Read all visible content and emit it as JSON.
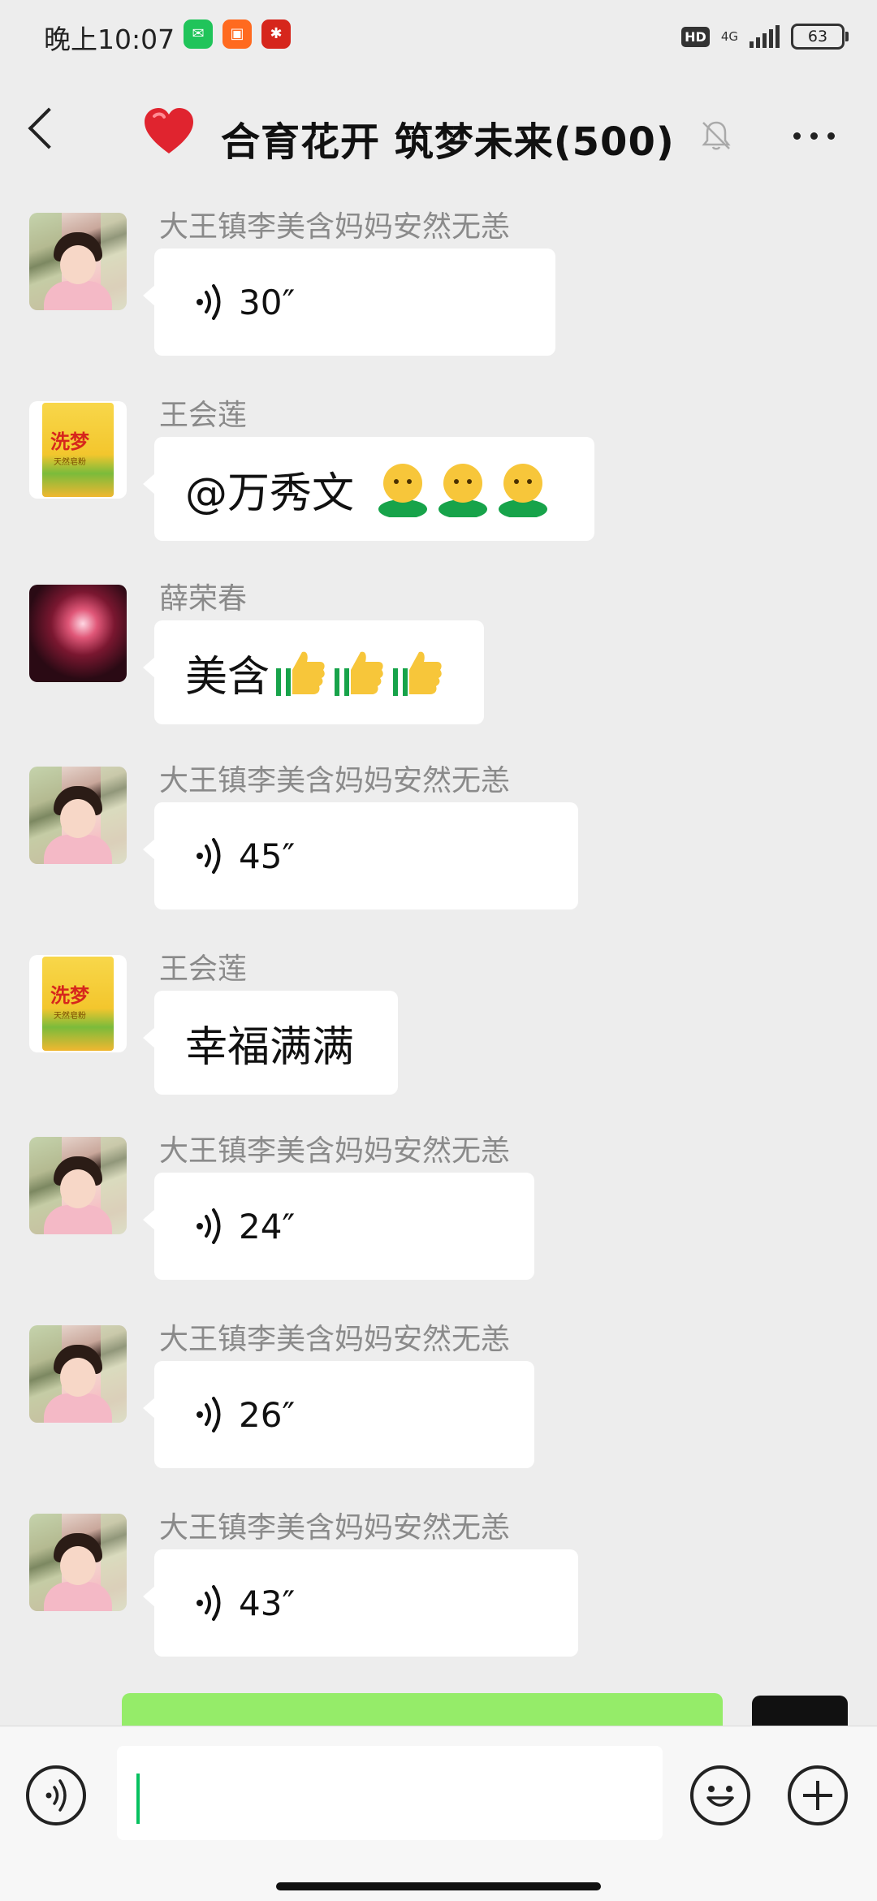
{
  "status_bar": {
    "time": "晚上10:07",
    "app_icons": [
      "wechat-icon",
      "taobao-icon",
      "xuexi-icon"
    ],
    "hd_label": "HD",
    "network": "4G",
    "battery": "63"
  },
  "header": {
    "title": "合育花开 筑梦未来(500)",
    "title_emoji": "heart-icon",
    "muted": true
  },
  "messages": [
    {
      "sender": "大王镇李美含妈妈安然无恙",
      "avatar": "girl-avatar",
      "type": "voice",
      "duration": "30″"
    },
    {
      "sender": "王会莲",
      "avatar": "bag-avatar",
      "type": "text",
      "text": "@万秀文",
      "emoji": [
        "smiley-icon",
        "smiley-icon",
        "smiley-icon"
      ]
    },
    {
      "sender": "薛荣春",
      "avatar": "fireworks-avatar",
      "type": "text",
      "text": "美含",
      "emoji": [
        "thumbs-up-icon",
        "thumbs-up-icon",
        "thumbs-up-icon"
      ]
    },
    {
      "sender": "大王镇李美含妈妈安然无恙",
      "avatar": "girl-avatar",
      "type": "voice",
      "duration": "45″"
    },
    {
      "sender": "王会莲",
      "avatar": "bag-avatar",
      "type": "text",
      "text": "幸福满满"
    },
    {
      "sender": "大王镇李美含妈妈安然无恙",
      "avatar": "girl-avatar",
      "type": "voice",
      "duration": "24″"
    },
    {
      "sender": "大王镇李美含妈妈安然无恙",
      "avatar": "girl-avatar",
      "type": "voice",
      "duration": "26″"
    },
    {
      "sender": "大王镇李美含妈妈安然无恙",
      "avatar": "girl-avatar",
      "type": "voice",
      "duration": "43″"
    }
  ],
  "bag_brand": "洗梦",
  "bag_sub": "天然皂粉",
  "input": {
    "value": ""
  },
  "colors": {
    "background": "#ededed",
    "bubble": "#ffffff",
    "self_bubble": "#95ec69",
    "caret": "#07c160"
  }
}
